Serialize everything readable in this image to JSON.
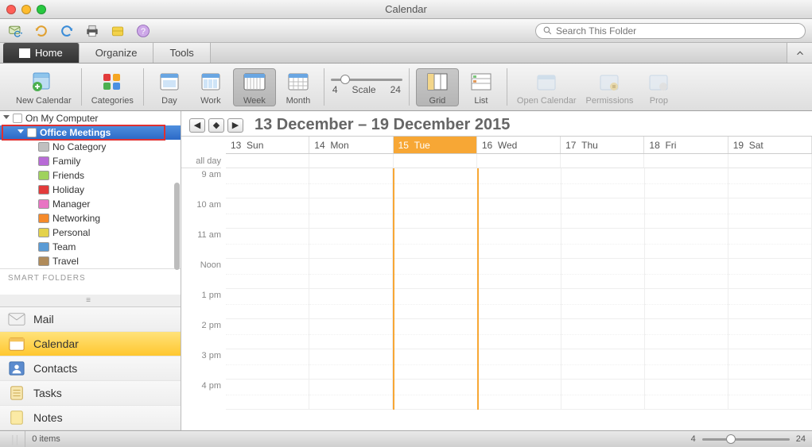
{
  "window": {
    "title": "Calendar"
  },
  "search": {
    "placeholder": "Search This Folder"
  },
  "tabs": {
    "home": "Home",
    "organize": "Organize",
    "tools": "Tools"
  },
  "ribbon": {
    "new_calendar": "New Calendar",
    "categories": "Categories",
    "day": "Day",
    "work": "Work",
    "week": "Week",
    "month": "Month",
    "scale_lo": "4",
    "scale_label": "Scale",
    "scale_hi": "24",
    "grid": "Grid",
    "list": "List",
    "open_calendar": "Open Calendar",
    "permissions": "Permissions",
    "properties": "Prop"
  },
  "tree": {
    "root": "On My Computer",
    "office_meetings": "Office Meetings",
    "categories": [
      {
        "label": "No Category",
        "color": "#c0c0c0"
      },
      {
        "label": "Family",
        "color": "#b86bd6"
      },
      {
        "label": "Friends",
        "color": "#9fd25d"
      },
      {
        "label": "Holiday",
        "color": "#e23b3b"
      },
      {
        "label": "Manager",
        "color": "#e874c3"
      },
      {
        "label": "Networking",
        "color": "#f58a2b"
      },
      {
        "label": "Personal",
        "color": "#e4d24a"
      },
      {
        "label": "Team",
        "color": "#5a9bd5"
      },
      {
        "label": "Travel",
        "color": "#b08b5a"
      }
    ],
    "smart_label": "SMART FOLDERS"
  },
  "nav": {
    "mail": "Mail",
    "calendar": "Calendar",
    "contacts": "Contacts",
    "tasks": "Tasks",
    "notes": "Notes"
  },
  "cal": {
    "range": "13 December – 19 December 2015",
    "allday_label": "all day",
    "days": [
      {
        "label": "13",
        "name": "Sun",
        "today": false
      },
      {
        "label": "14",
        "name": "Mon",
        "today": false
      },
      {
        "label": "15",
        "name": "Tue",
        "today": true
      },
      {
        "label": "16",
        "name": "Wed",
        "today": false
      },
      {
        "label": "17",
        "name": "Thu",
        "today": false
      },
      {
        "label": "18",
        "name": "Fri",
        "today": false
      },
      {
        "label": "19",
        "name": "Sat",
        "today": false
      }
    ],
    "times": [
      "9 am",
      "10 am",
      "11 am",
      "Noon",
      "1 pm",
      "2 pm",
      "3 pm",
      "4 pm"
    ]
  },
  "status": {
    "items": "0 items",
    "lo": "4",
    "hi": "24"
  },
  "colors": {
    "today": "#f7a735",
    "selection": "#2b69c7"
  }
}
